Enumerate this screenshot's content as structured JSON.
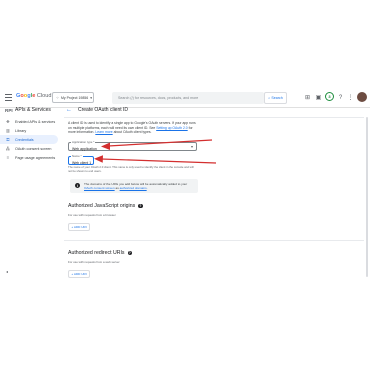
{
  "topbar": {
    "logo_google": "Google",
    "logo_cloud": "Cloud",
    "project": "My Project 19856",
    "search_placeholder": "Search (/) for resources, docs, products, and more",
    "search_button": "Search",
    "notification_count": "3"
  },
  "nav": {
    "api_logo": "RPI",
    "title": "APIs & Services",
    "items": [
      {
        "icon": "✥",
        "label": "Enabled APIs & services"
      },
      {
        "icon": "▥",
        "label": "Library"
      },
      {
        "icon": "⚿",
        "label": "Credentials"
      },
      {
        "icon": "⁂",
        "label": "OAuth consent screen"
      },
      {
        "icon": "≡",
        "label": "Page usage agreements"
      }
    ],
    "collapse": "◂"
  },
  "page": {
    "back": "←",
    "title": "Create OAuth client ID",
    "desc_1": "A client ID is used to identify a single app to Google's OAuth servers. If your app runs on multiple platforms, each will need its own client ID. See ",
    "desc_link_1": "Setting up OAuth 2.0",
    "desc_2": " for more information. ",
    "desc_link_2": "Learn more",
    "desc_3": " about OAuth client types.",
    "app_type_label": "Application type *",
    "app_type_value": "Web application",
    "name_label": "Name *",
    "name_value": "Web client 1",
    "name_hint": "The name of your OAuth 2.0 client. This name is only used to identify the client in the console and will not be shown to end users.",
    "notice_1": "The domains of the URIs you add below will be automatically added to your ",
    "notice_link_1": "OAuth consent screen",
    "notice_2": " as ",
    "notice_link_2": "authorized domains",
    "notice_3": ".",
    "js_title": "Authorized JavaScript origins",
    "js_sub": "For use with requests from a browser",
    "add_uri": "+ ADD URI",
    "redirect_title": "Authorized redirect URIs",
    "redirect_sub": "For use with requests from a web server"
  },
  "colors": {
    "accent": "#1a73e8",
    "annotation": "#d32f2f"
  }
}
